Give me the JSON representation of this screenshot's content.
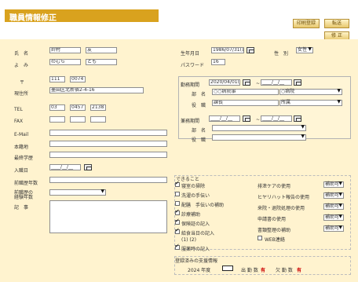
{
  "header": {
    "title": "職員情報修正",
    "buttons": {
      "regdel": "印刷登録",
      "new": "転送",
      "cont": "修 正"
    }
  },
  "form": {
    "name_label": "氏　名",
    "name_last": "鈴村",
    "name_first": "友",
    "kana_label": "よ　み",
    "kana_last": "のむら",
    "kana_first": "とも",
    "dob_label": "生年月日",
    "dob": "1986/07/31(日)",
    "gender_label": "性　別",
    "gender": "女性",
    "password_label": "パスワード",
    "password": "16",
    "postal_label": "〒",
    "postal1": "111",
    "postal2": "0074",
    "address_label": "現住所",
    "address": "墨田区北新宿2-4-16",
    "tel_label": "TEL",
    "tel1": "03",
    "tel2": "0457",
    "tel3": "2138",
    "fax_label": "FAX",
    "email_label": "E-Mail",
    "homeplace_label": "本籍地",
    "school_label": "最終学歴",
    "join_label": "入職日",
    "join_date": "____/__/__",
    "prev_label": "前職歴年数",
    "prev2_label": "前職歴の\n経験年数",
    "note_label": "記　事"
  },
  "work": {
    "period1_label": "勤務期間",
    "period1_from": "2020/04/01(水)",
    "period1_to": "____/__/__",
    "dept_label": "部　名",
    "dept_value": "○○病院事",
    "role_label": "役　職",
    "role_value": "課長",
    "period2_label": "兼務期間",
    "period2_from": "____/__/__",
    "period2_to": "____/__/__",
    "dept2_label": "部　名",
    "role2_label": "役　職",
    "ghost1": "○病院",
    "ghost2": "所属"
  },
  "skills": {
    "title": "できること",
    "left": [
      {
        "label": "寝室の掃除",
        "checked": true
      },
      {
        "label": "洗濯の手伝い",
        "checked": false
      },
      {
        "label": "配膳　手伝いの補助",
        "checked": false
      },
      {
        "label": "診療補助",
        "checked": true
      },
      {
        "label": "保険証の記入",
        "checked": true
      },
      {
        "label": "給食当日の記入",
        "checked": true
      },
      {
        "label": "(1)  (2)",
        "checked": false
      },
      {
        "label": "服薬時の記入",
        "checked": true
      }
    ],
    "right": [
      {
        "label": "排泄ケアの使用",
        "value": "補助可"
      },
      {
        "label": "ヒヤリハット報告の使用",
        "value": "補助可"
      },
      {
        "label": "来院・退院処理の使用",
        "value": "補助可"
      },
      {
        "label": "申請書の使用",
        "value": "補助可"
      },
      {
        "label": "書類整理の補助",
        "value": "補助可"
      },
      {
        "label": "WEB連絡",
        "value": ""
      }
    ]
  },
  "records": {
    "title": "登録済みの支援情報",
    "year": "2024 年度",
    "attendance_label": "出 勤 数",
    "attendance_value": "有",
    "vacation_label": "欠 勤 数",
    "vacation_value": "有"
  }
}
